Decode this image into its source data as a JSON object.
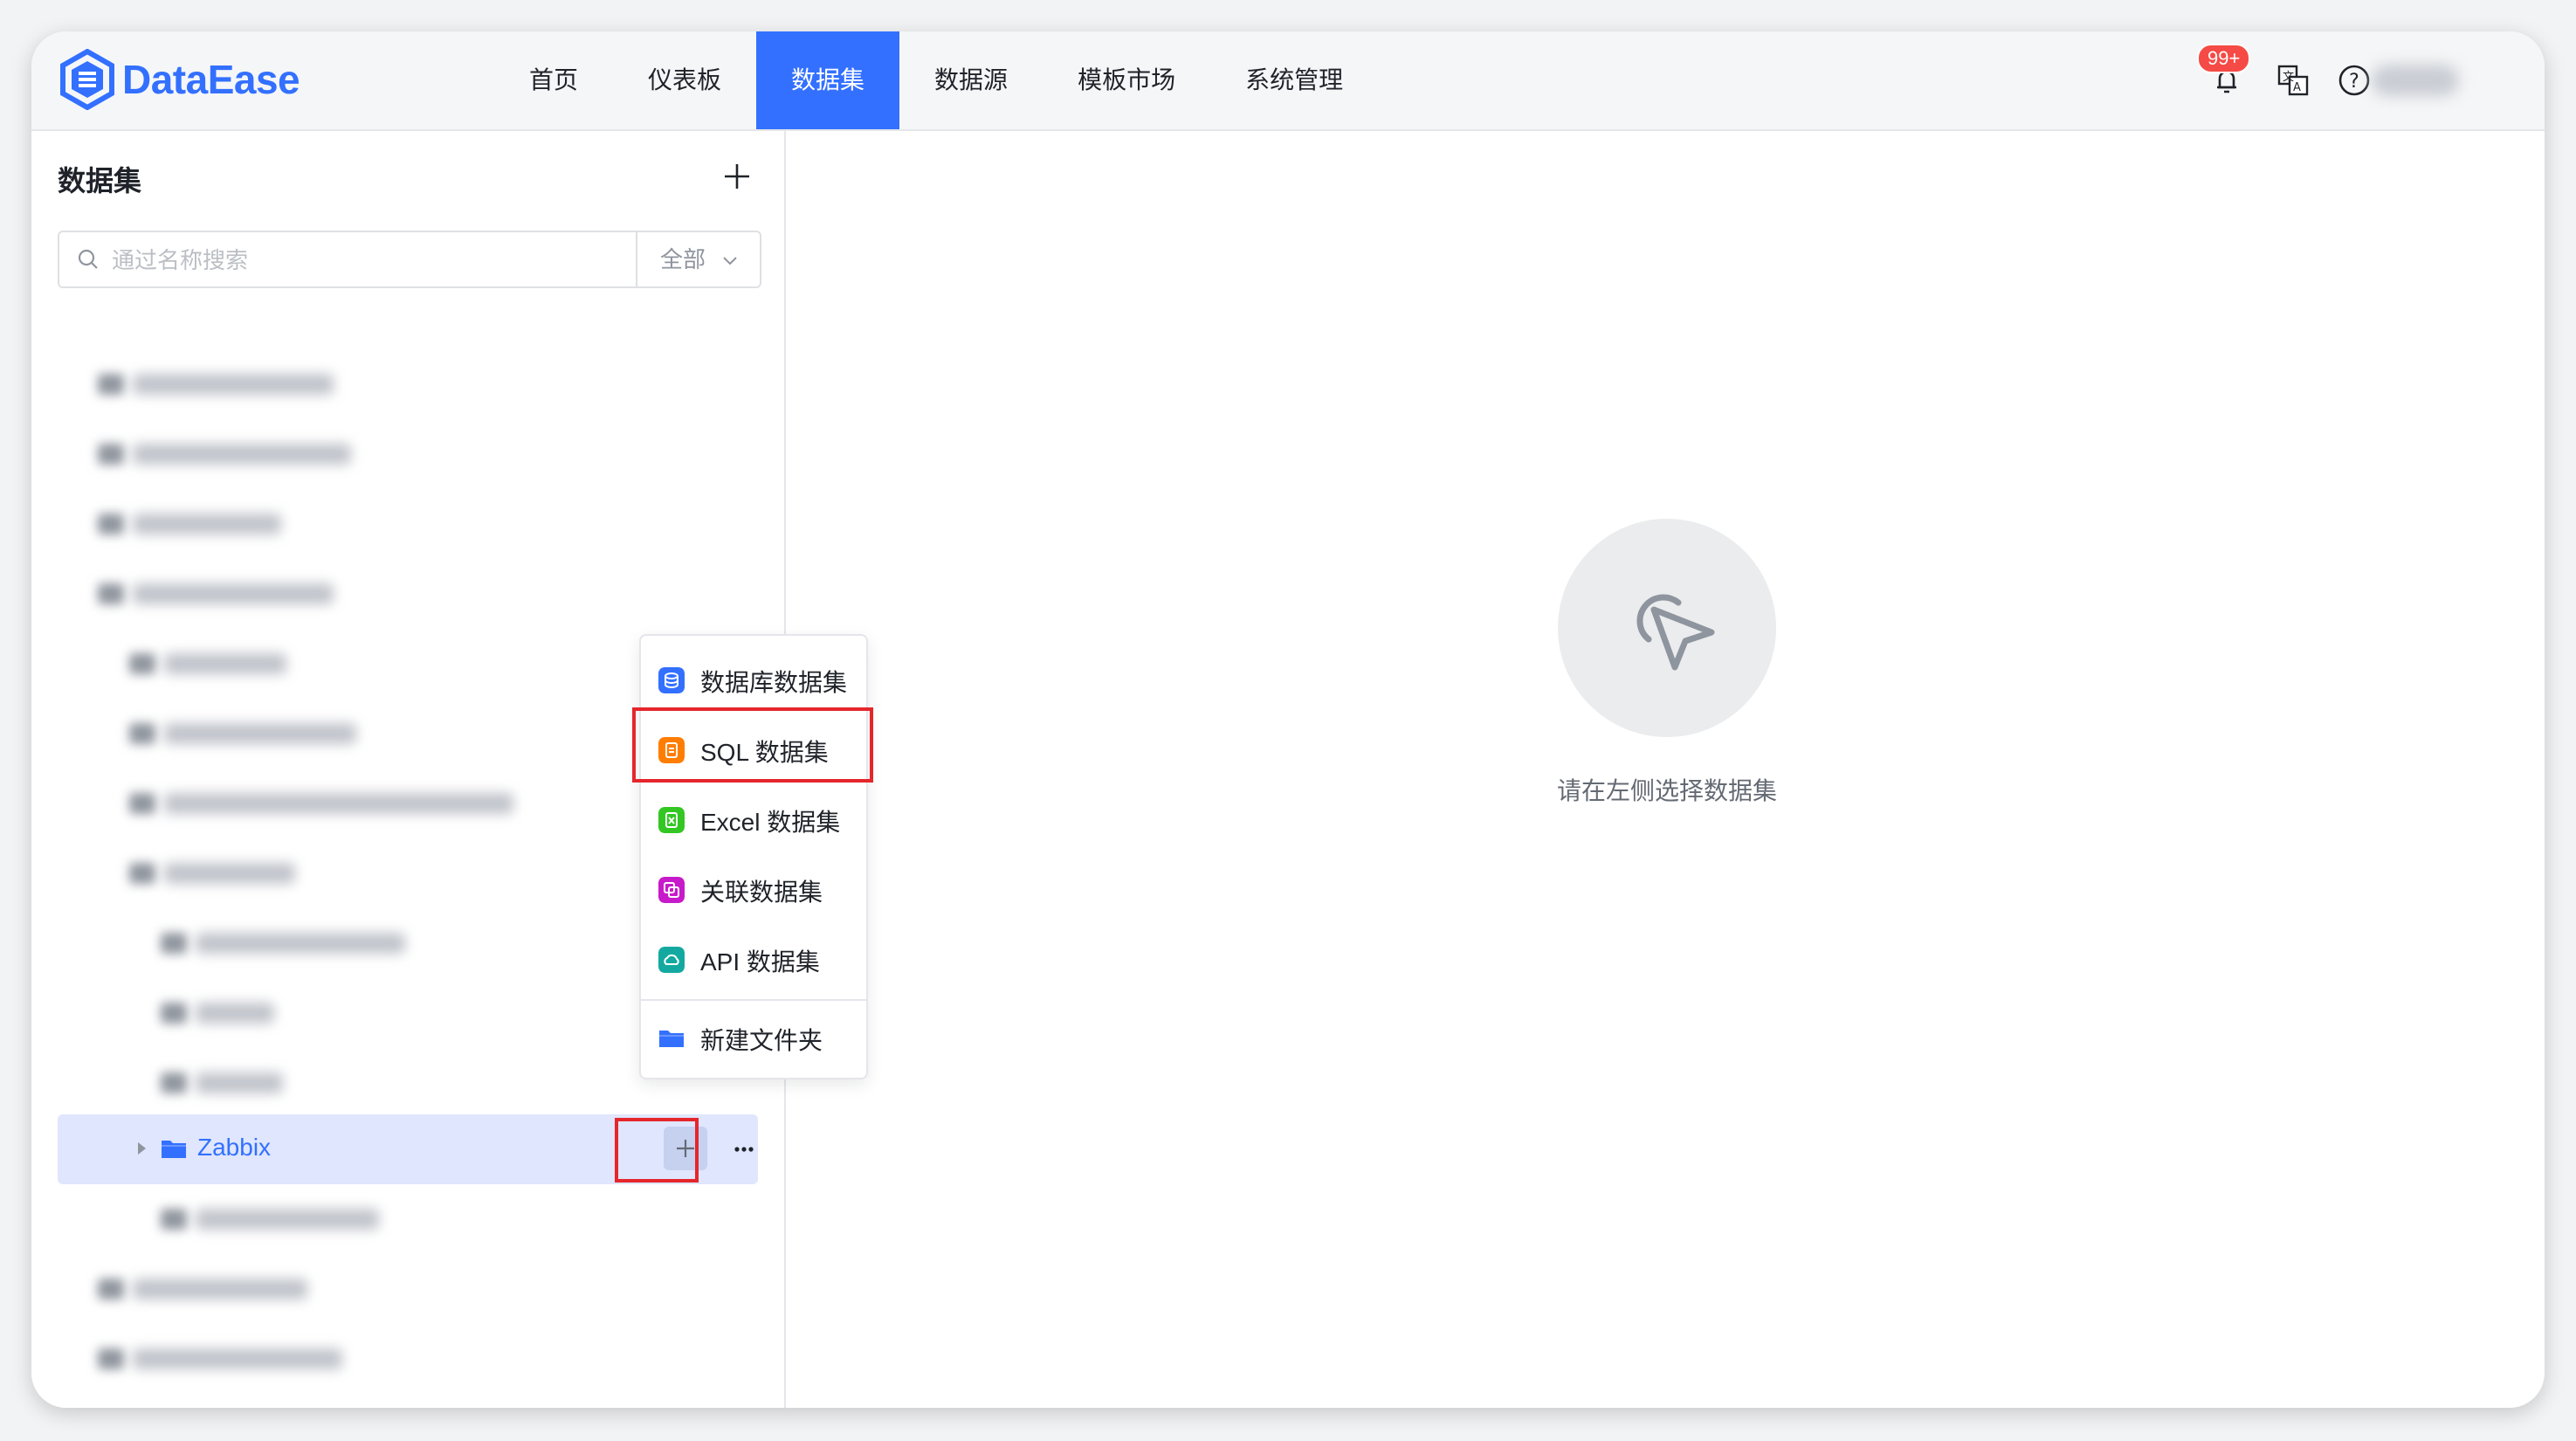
{
  "app": {
    "logo_text": "DataEase",
    "brand_color": "#3370ff"
  },
  "nav": {
    "items": [
      "首页",
      "仪表板",
      "数据集",
      "数据源",
      "模板市场",
      "系统管理"
    ],
    "active": "数据集"
  },
  "header": {
    "notification_badge": "99+",
    "icons": [
      "bell-icon",
      "translate-icon",
      "help-icon",
      "user-avatar"
    ]
  },
  "sidebar": {
    "title": "数据集",
    "search_placeholder": "通过名称搜索",
    "search_value": "",
    "filter_value": "全部",
    "selected_folder": "Zabbix"
  },
  "menu": {
    "items": [
      {
        "label": "数据库数据集",
        "icon": "database-icon",
        "color": "#3370ff"
      },
      {
        "label": "SQL 数据集",
        "icon": "sql-icon",
        "color": "#ff7d00"
      },
      {
        "label": "Excel 数据集",
        "icon": "excel-icon",
        "color": "#34c724"
      },
      {
        "label": "关联数据集",
        "icon": "union-icon",
        "color": "#c71aca"
      },
      {
        "label": "API 数据集",
        "icon": "api-icon",
        "color": "#14a9a0"
      },
      {
        "label": "新建文件夹",
        "icon": "folder-icon",
        "color": "#3370ff"
      }
    ],
    "highlighted": "SQL 数据集"
  },
  "empty_state": {
    "text": "请在左侧选择数据集"
  }
}
